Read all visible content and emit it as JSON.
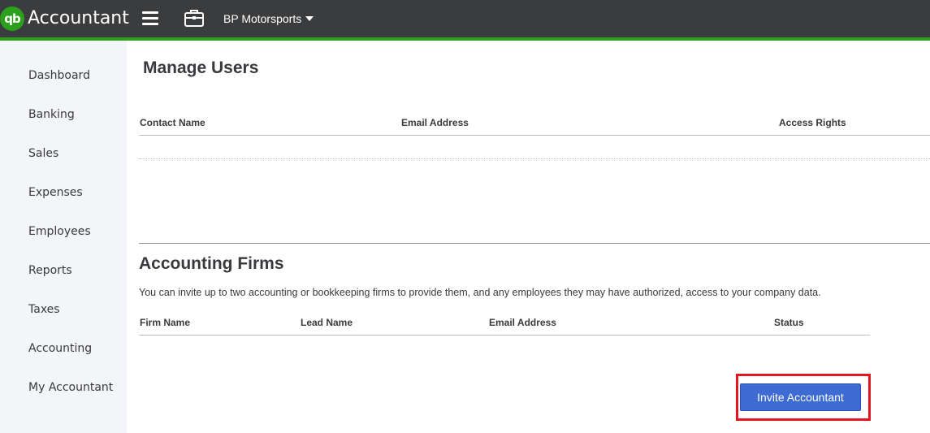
{
  "app": {
    "logo_text": "qb",
    "title": "Accountant",
    "company_name": "BP Motorsports",
    "icons": {
      "logo": "quickbooks-logo",
      "menu": "hamburger-menu-icon",
      "briefcase": "briefcase-icon",
      "caret": "caret-down-icon"
    },
    "colors": {
      "topbar": "#3b3c3e",
      "accent": "#2ca01c",
      "sidebar": "#f4f5f8",
      "primary_button": "#3d6bd1",
      "highlight_box": "#e3161f"
    }
  },
  "sidebar": {
    "items": [
      {
        "label": "Dashboard"
      },
      {
        "label": "Banking"
      },
      {
        "label": "Sales"
      },
      {
        "label": "Expenses"
      },
      {
        "label": "Employees"
      },
      {
        "label": "Reports"
      },
      {
        "label": "Taxes"
      },
      {
        "label": "Accounting"
      },
      {
        "label": "My Accountant"
      }
    ]
  },
  "manage_users": {
    "title": "Manage Users",
    "columns": [
      "Contact Name",
      "Email Address",
      "Access Rights"
    ],
    "rows": []
  },
  "accounting_firms": {
    "title": "Accounting Firms",
    "description": "You can invite up to two accounting or bookkeeping firms to provide them, and any employees they may have authorized, access to your company data.",
    "columns": [
      "Firm Name",
      "Lead Name",
      "Email Address",
      "Status"
    ],
    "rows": [],
    "invite_button": "Invite Accountant"
  }
}
